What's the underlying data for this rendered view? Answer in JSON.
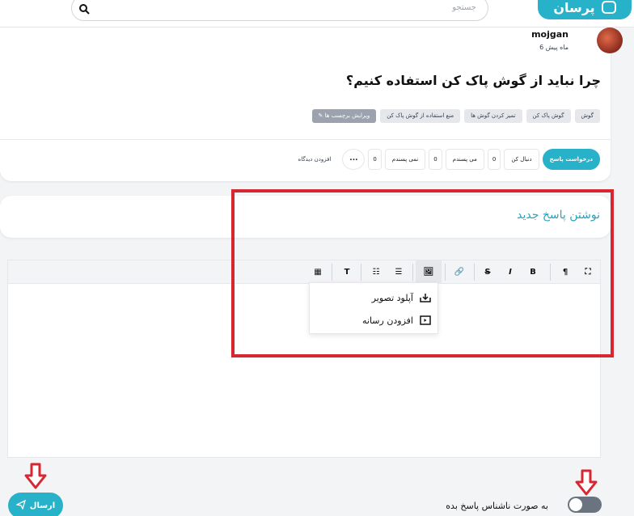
{
  "header": {
    "logo_text": "پرسان",
    "search_placeholder": "جستجو"
  },
  "question": {
    "author": "mojgan",
    "time": "6 ماه پیش",
    "title": "چرا نباید از گوش پاک کن استفاده کنیم؟",
    "tags": [
      "گوش",
      "گوش پاک کن",
      "تمیز کردن گوش ها",
      "منع استفاده از گوش پاک کن"
    ],
    "edit_tags_label": "ویرایش برچسب ها",
    "actions": {
      "request_answer": "درخواست پاسخ",
      "follow": "دنبال کن",
      "follow_count": "0",
      "like": "می پسندم",
      "like_count": "0",
      "dislike": "نمی پسندم",
      "dislike_count": "0",
      "more": "...",
      "add_comment": "افزودن دیدگاه"
    }
  },
  "answer": {
    "title": "نوشتن پاسخ جدید"
  },
  "editor": {
    "toolbar": {
      "fullscreen": "⛶",
      "paragraph": "¶",
      "bold": "B",
      "italic": "I",
      "strike": "S",
      "link": "🔗",
      "image": "🖼",
      "bullet_list": "☰",
      "ordered_list": "☷",
      "clear_format": "T",
      "code": "▦"
    },
    "image_menu": {
      "upload_image": "آپلود تصویر",
      "add_media": "افزودن رسانه"
    }
  },
  "footer": {
    "anonymous_label": "به صورت ناشناس پاسخ بده",
    "anonymous_on": false,
    "send_label": "ارسال"
  },
  "colors": {
    "accent": "#27b2c9",
    "annotation_red": "#d72730"
  }
}
